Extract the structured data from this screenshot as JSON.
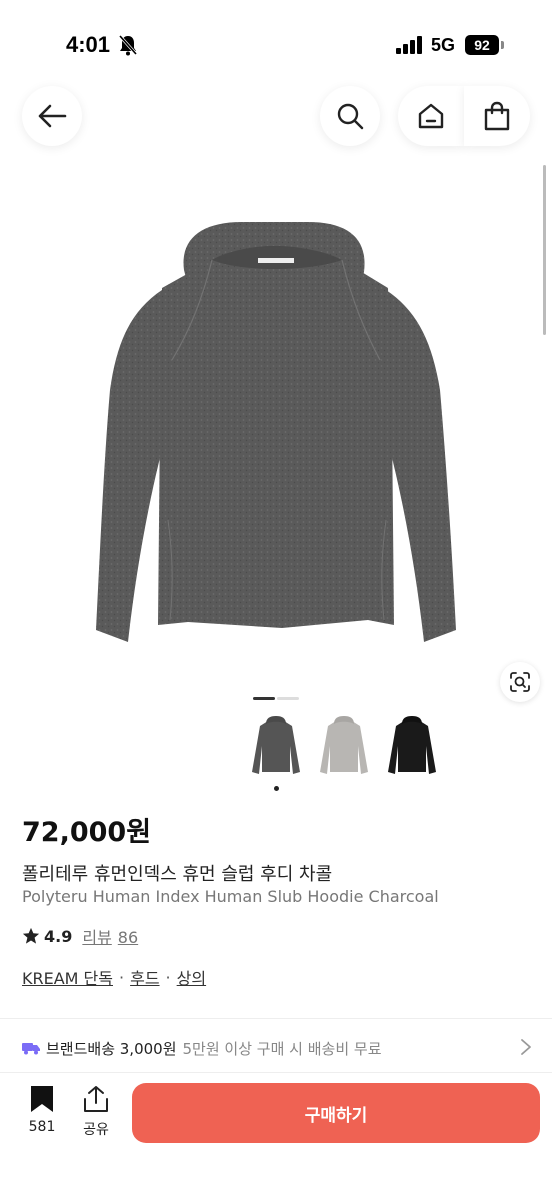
{
  "status_bar": {
    "time": "4:01",
    "network": "5G",
    "battery": "92"
  },
  "nav": {
    "back_icon": "arrow-left-icon",
    "search_icon": "search-icon",
    "home_icon": "home-icon",
    "bag_icon": "shopping-bag-icon"
  },
  "gallery": {
    "page_indicator_current": 1,
    "page_indicator_total": 2,
    "selected_variant": 1,
    "variants": [
      "charcoal",
      "light-gray",
      "black"
    ]
  },
  "product": {
    "price": "72,000원",
    "name_ko": "폴리테루 휴먼인덱스 휴먼 슬럽 후디 차콜",
    "name_en": "Polyteru Human Index Human Slub Hoodie Charcoal",
    "rating": "4.9",
    "review_label": "리뷰",
    "review_count": "86",
    "tags": [
      "KREAM 단독",
      "후드",
      "상의"
    ]
  },
  "shipping": {
    "label": "브랜드배송 3,000원",
    "note": "5만원 이상 구매 시 배송비 무료"
  },
  "bottom_bar": {
    "bookmark_count": "581",
    "share_label": "공유",
    "buy_label": "구매하기"
  },
  "colors": {
    "accent": "#ef6253",
    "hoodie_charcoal": "#5a5a5a",
    "hoodie_gray": "#b8b6b3",
    "hoodie_black": "#1a1a1a",
    "shipping_icon": "#7b6cf6"
  }
}
